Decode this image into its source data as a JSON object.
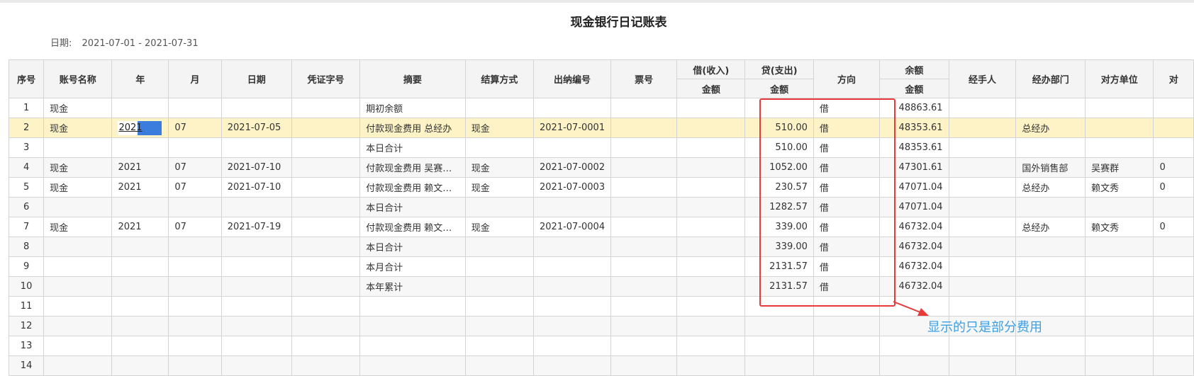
{
  "report": {
    "title": "现金银行日记账表",
    "date_label": "日期:",
    "date_range": "2021-07-01 - 2021-07-31"
  },
  "table": {
    "headers": {
      "seq": "序号",
      "account": "账号名称",
      "year": "年",
      "month": "月",
      "date": "日期",
      "voucher": "凭证字号",
      "summary": "摘要",
      "settlement": "结算方式",
      "cashier_no": "出纳编号",
      "ticket_no": "票号",
      "debit": "借(收入)",
      "credit": "贷(支出)",
      "amount": "金额",
      "direction": "方向",
      "balance": "余额",
      "handler": "经手人",
      "department": "经办部门",
      "counterparty": "对方单位",
      "extra": "对"
    },
    "rows": [
      {
        "seq": "1",
        "account": "现金",
        "year": "",
        "month": "",
        "date": "",
        "voucher": "",
        "summary": "期初余额",
        "settlement": "",
        "cashier_no": "",
        "ticket_no": "",
        "debit": "",
        "credit": "",
        "direction": "借",
        "balance": "48863.61",
        "handler": "",
        "department": "",
        "counterparty": "",
        "extra": ""
      },
      {
        "seq": "2",
        "account": "现金",
        "year": "2021",
        "month": "07",
        "date": "2021-07-05",
        "voucher": "",
        "summary": "付款现金费用 总经办",
        "settlement": "现金",
        "cashier_no": "2021-07-0001",
        "ticket_no": "",
        "debit": "",
        "credit": "510.00",
        "direction": "借",
        "balance": "48353.61",
        "handler": "",
        "department": "总经办",
        "counterparty": "",
        "extra": ""
      },
      {
        "seq": "3",
        "account": "",
        "year": "",
        "month": "",
        "date": "",
        "voucher": "",
        "summary": "本日合计",
        "settlement": "",
        "cashier_no": "",
        "ticket_no": "",
        "debit": "",
        "credit": "510.00",
        "direction": "借",
        "balance": "48353.61",
        "handler": "",
        "department": "",
        "counterparty": "",
        "extra": ""
      },
      {
        "seq": "4",
        "account": "现金",
        "year": "2021",
        "month": "07",
        "date": "2021-07-10",
        "voucher": "",
        "summary": "付款现金费用 吴赛…",
        "settlement": "现金",
        "cashier_no": "2021-07-0002",
        "ticket_no": "",
        "debit": "",
        "credit": "1052.00",
        "direction": "借",
        "balance": "47301.61",
        "handler": "",
        "department": "国外销售部",
        "counterparty": "吴赛群",
        "extra": "0"
      },
      {
        "seq": "5",
        "account": "现金",
        "year": "2021",
        "month": "07",
        "date": "2021-07-10",
        "voucher": "",
        "summary": "付款现金费用 赖文…",
        "settlement": "现金",
        "cashier_no": "2021-07-0003",
        "ticket_no": "",
        "debit": "",
        "credit": "230.57",
        "direction": "借",
        "balance": "47071.04",
        "handler": "",
        "department": "总经办",
        "counterparty": "赖文秀",
        "extra": "0"
      },
      {
        "seq": "6",
        "account": "",
        "year": "",
        "month": "",
        "date": "",
        "voucher": "",
        "summary": "本日合计",
        "settlement": "",
        "cashier_no": "",
        "ticket_no": "",
        "debit": "",
        "credit": "1282.57",
        "direction": "借",
        "balance": "47071.04",
        "handler": "",
        "department": "",
        "counterparty": "",
        "extra": ""
      },
      {
        "seq": "7",
        "account": "现金",
        "year": "2021",
        "month": "07",
        "date": "2021-07-19",
        "voucher": "",
        "summary": "付款现金费用 赖文…",
        "settlement": "现金",
        "cashier_no": "2021-07-0004",
        "ticket_no": "",
        "debit": "",
        "credit": "339.00",
        "direction": "借",
        "balance": "46732.04",
        "handler": "",
        "department": "总经办",
        "counterparty": "赖文秀",
        "extra": "0"
      },
      {
        "seq": "8",
        "account": "",
        "year": "",
        "month": "",
        "date": "",
        "voucher": "",
        "summary": "本日合计",
        "settlement": "",
        "cashier_no": "",
        "ticket_no": "",
        "debit": "",
        "credit": "339.00",
        "direction": "借",
        "balance": "46732.04",
        "handler": "",
        "department": "",
        "counterparty": "",
        "extra": ""
      },
      {
        "seq": "9",
        "account": "",
        "year": "",
        "month": "",
        "date": "",
        "voucher": "",
        "summary": "本月合计",
        "settlement": "",
        "cashier_no": "",
        "ticket_no": "",
        "debit": "",
        "credit": "2131.57",
        "direction": "借",
        "balance": "46732.04",
        "handler": "",
        "department": "",
        "counterparty": "",
        "extra": ""
      },
      {
        "seq": "10",
        "account": "",
        "year": "",
        "month": "",
        "date": "",
        "voucher": "",
        "summary": "本年累计",
        "settlement": "",
        "cashier_no": "",
        "ticket_no": "",
        "debit": "",
        "credit": "2131.57",
        "direction": "借",
        "balance": "46732.04",
        "handler": "",
        "department": "",
        "counterparty": "",
        "extra": ""
      },
      {
        "seq": "11",
        "account": "",
        "year": "",
        "month": "",
        "date": "",
        "voucher": "",
        "summary": "",
        "settlement": "",
        "cashier_no": "",
        "ticket_no": "",
        "debit": "",
        "credit": "",
        "direction": "",
        "balance": "",
        "handler": "",
        "department": "",
        "counterparty": "",
        "extra": ""
      },
      {
        "seq": "12",
        "account": "",
        "year": "",
        "month": "",
        "date": "",
        "voucher": "",
        "summary": "",
        "settlement": "",
        "cashier_no": "",
        "ticket_no": "",
        "debit": "",
        "credit": "",
        "direction": "",
        "balance": "",
        "handler": "",
        "department": "",
        "counterparty": "",
        "extra": ""
      },
      {
        "seq": "13",
        "account": "",
        "year": "",
        "month": "",
        "date": "",
        "voucher": "",
        "summary": "",
        "settlement": "",
        "cashier_no": "",
        "ticket_no": "",
        "debit": "",
        "credit": "",
        "direction": "",
        "balance": "",
        "handler": "",
        "department": "",
        "counterparty": "",
        "extra": ""
      },
      {
        "seq": "14",
        "account": "",
        "year": "",
        "month": "",
        "date": "",
        "voucher": "",
        "summary": "",
        "settlement": "",
        "cashier_no": "",
        "ticket_no": "",
        "debit": "",
        "credit": "",
        "direction": "",
        "balance": "",
        "handler": "",
        "department": "",
        "counterparty": "",
        "extra": ""
      }
    ]
  },
  "annotation": {
    "text": "显示的只是部分费用",
    "color": "#3aa0e6",
    "box_color": "#e83a3a"
  },
  "colors": {
    "highlight_row": "#fdf3c7",
    "selection": "#3b7ddd"
  }
}
